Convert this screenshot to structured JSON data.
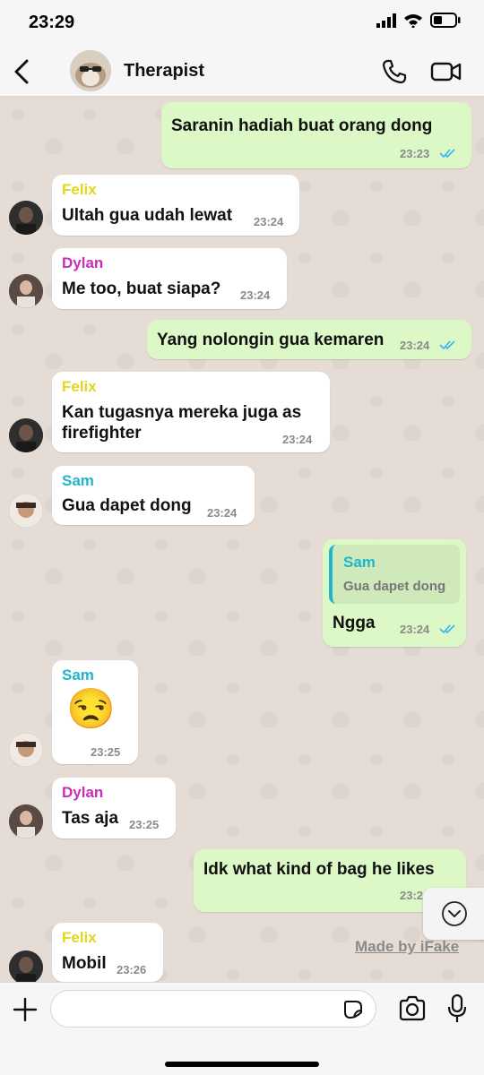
{
  "status": {
    "time": "23:29"
  },
  "header": {
    "title": "Therapist"
  },
  "messages": [
    {
      "id": "m1",
      "text": "Saranin hadiah buat orang dong",
      "time": "23:23"
    },
    {
      "id": "m2",
      "sender": "Felix",
      "text": "Ultah gua udah lewat",
      "time": "23:24"
    },
    {
      "id": "m3",
      "sender": "Dylan",
      "text": "Me too, buat siapa?",
      "time": "23:24"
    },
    {
      "id": "m4",
      "text": "Yang nolongin gua kemaren",
      "time": "23:24"
    },
    {
      "id": "m5",
      "sender": "Felix",
      "text_line1": "Kan tugasnya mereka juga as",
      "text_line2": "firefighter",
      "time": "23:24"
    },
    {
      "id": "m6",
      "sender": "Sam",
      "text": "Gua dapet dong",
      "time": "23:24"
    },
    {
      "id": "m7",
      "quote_name": "Sam",
      "quote_text": "Gua dapet dong",
      "text": "Ngga",
      "time": "23:24"
    },
    {
      "id": "m8",
      "sender": "Sam",
      "emoji": "😒",
      "time": "23:25"
    },
    {
      "id": "m9",
      "sender": "Dylan",
      "text": "Tas aja",
      "time": "23:25"
    },
    {
      "id": "m10",
      "text": "Idk what kind of bag he likes",
      "time": "23:2"
    },
    {
      "id": "m11",
      "sender": "Felix",
      "text": "Mobil",
      "time": "23:26"
    }
  ],
  "watermark": "Made by iFake",
  "colors": {
    "felix": "#e3d61b",
    "dylan": "#c32fb8",
    "sam": "#1fb6c9",
    "outgoing": "#dcf8c6",
    "tick": "#34b7f1"
  }
}
